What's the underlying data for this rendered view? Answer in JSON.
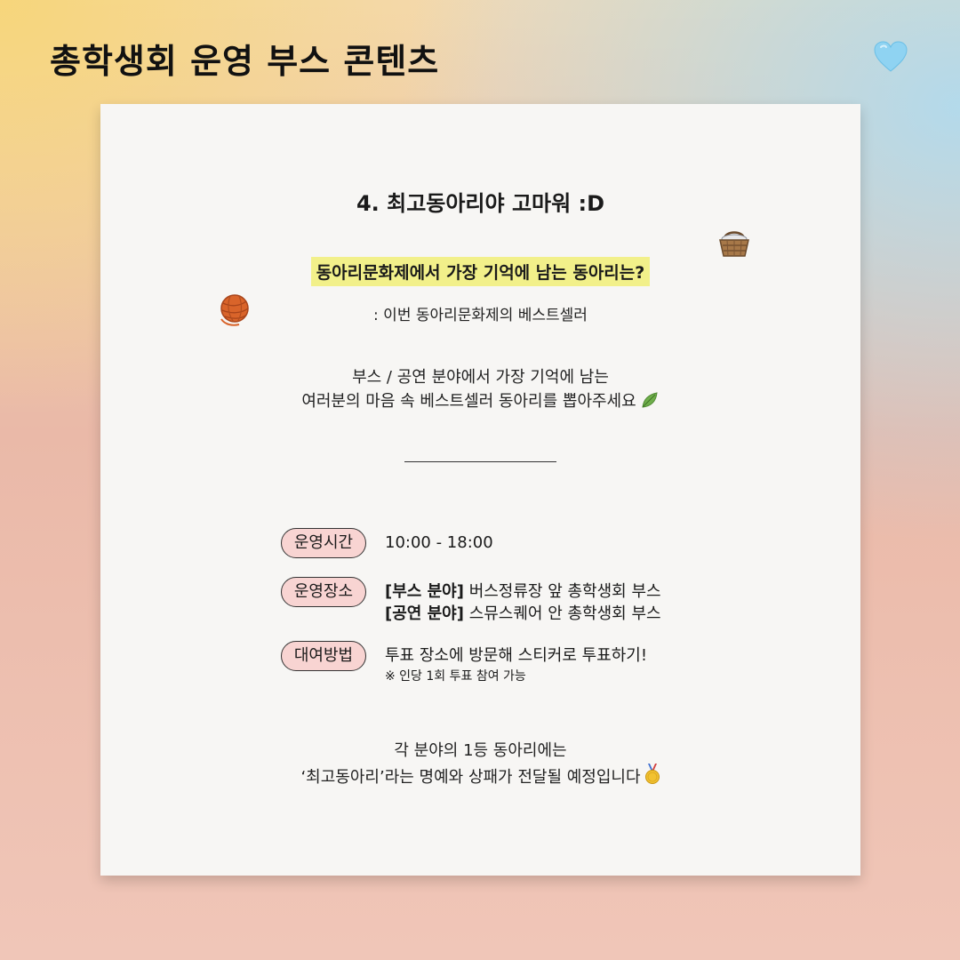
{
  "header": {
    "title": "총학생회 운영 부스 콘텐츠",
    "heart_icon": "light-blue-heart-icon"
  },
  "card": {
    "title": "4.  최고동아리야 고마워 :D",
    "question": "동아리문화제에서 가장 기억에 남는 동아리는?",
    "subtitle": ": 이번 동아리문화제의 베스트셀러",
    "desc_line1": "부스 / 공연 분야에서 가장 기억에 남는",
    "desc_line2": "여러분의 마음 속 베스트셀러 동아리를 뽑아주세요",
    "info": [
      {
        "label": "운영시간",
        "line1": "10:00 - 18:00"
      },
      {
        "label": "운영장소",
        "line1_bold": "[부스 분야]",
        "line1": " 버스정류장 앞 총학생회 부스",
        "line2_bold": "[공연 분야]",
        "line2": " 스뮤스퀘어 안 총학생회 부스"
      },
      {
        "label": "대여방법",
        "line1": "투표 장소에 방문해 스티커로 투표하기!",
        "note": "※ 인당 1회 투표 참여 가능"
      }
    ],
    "closing_line1": "각 분야의 1등 동아리에는",
    "closing_line2": "‘최고동아리’라는 명예와 상패가 전달될 예정입니다",
    "icons": [
      "basket-icon",
      "yarn-ball-icon",
      "leaf-icon",
      "gold-medal-icon"
    ],
    "colors": {
      "highlight": "#f2f08a",
      "pill_fill": "#f8d4d2",
      "card": "#f7f6f4"
    }
  }
}
